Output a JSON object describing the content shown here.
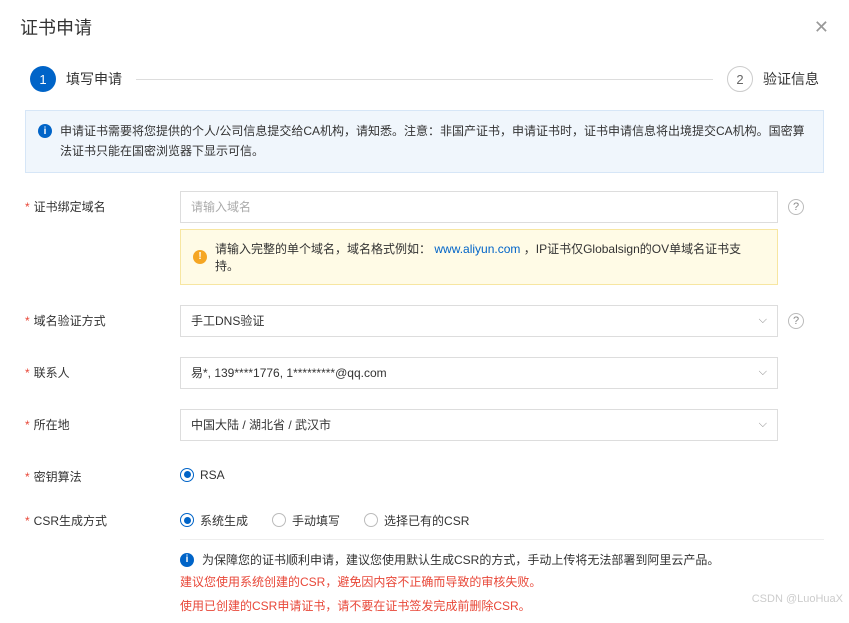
{
  "header": {
    "title": "证书申请"
  },
  "steps": {
    "step1": {
      "num": "1",
      "label": "填写申请"
    },
    "step2": {
      "num": "2",
      "label": "验证信息"
    }
  },
  "notice": "申请证书需要将您提供的个人/公司信息提交给CA机构，请知悉。注意：非国产证书，申请证书时，证书申请信息将出境提交CA机构。国密算法证书只能在国密浏览器下显示可信。",
  "fields": {
    "domain": {
      "label": "证书绑定域名",
      "placeholder": "请输入域名",
      "hint_pre": "请输入完整的单个域名，域名格式例如：",
      "hint_link": "www.aliyun.com",
      "hint_post": "，IP证书仅Globalsign的OV单域名证书支持。"
    },
    "verify": {
      "label": "域名验证方式",
      "value": "手工DNS验证"
    },
    "contact": {
      "label": "联系人",
      "value": "易*, 139****1776, 1*********@qq.com"
    },
    "location": {
      "label": "所在地",
      "value": "中国大陆 / 湖北省 / 武汉市"
    },
    "key_algo": {
      "label": "密钥算法",
      "option1": "RSA"
    },
    "csr": {
      "label": "CSR生成方式",
      "option1": "系统生成",
      "option2": "手动填写",
      "option3": "选择已有的CSR",
      "info": "为保障您的证书顺利申请，建议您使用默认生成CSR的方式，手动上传将无法部署到阿里云产品。",
      "warn1": "建议您使用系统创建的CSR，避免因内容不正确而导致的审核失败。",
      "warn2": "使用已创建的CSR申请证书，请不要在证书签发完成前删除CSR。"
    }
  },
  "watermark": "CSDN @LuoHuaX"
}
